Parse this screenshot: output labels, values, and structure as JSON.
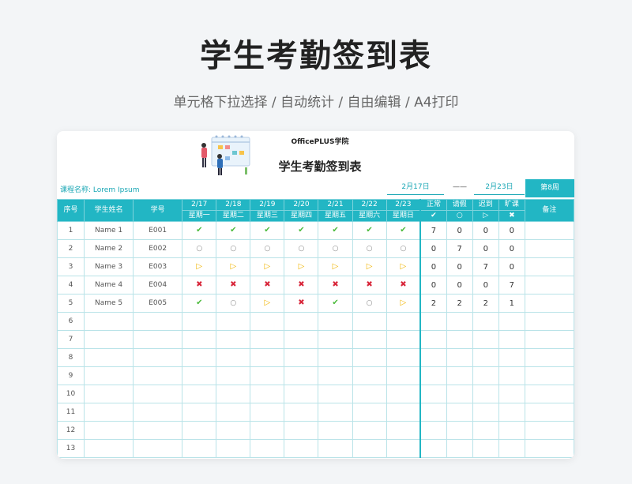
{
  "header": {
    "title": "学生考勤签到表",
    "subtitle": "单元格下拉选择 / 自动统计 / 自由编辑 / A4打印"
  },
  "sheet": {
    "org": "OfficePLUS学院",
    "title": "学生考勤签到表",
    "course_label": "课程名称:",
    "course_name": "Lorem Ipsum",
    "start_date": "2月17日",
    "separator": "——",
    "end_date": "2月23日",
    "week": "第8周"
  },
  "columns": {
    "seq": "序号",
    "name": "学生姓名",
    "id": "学号",
    "dates": [
      "2/17",
      "2/18",
      "2/19",
      "2/20",
      "2/21",
      "2/22",
      "2/23"
    ],
    "weekdays": [
      "星期一",
      "星期二",
      "星期三",
      "星期四",
      "星期五",
      "星期六",
      "星期日"
    ],
    "summary": [
      {
        "label": "正常",
        "symbol": "✔"
      },
      {
        "label": "请假",
        "symbol": "○"
      },
      {
        "label": "迟到",
        "symbol": "▷"
      },
      {
        "label": "旷课",
        "symbol": "✖"
      }
    ],
    "note": "备注"
  },
  "status_colors": {
    "check": "#4cbb3c",
    "leave": "#888888",
    "late": "#f0b400",
    "absent": "#d8263a",
    "accent": "#22b6c4"
  },
  "rows": [
    {
      "seq": "1",
      "name": "Name 1",
      "id": "E001",
      "marks": [
        "✔",
        "✔",
        "✔",
        "✔",
        "✔",
        "✔",
        "✔"
      ],
      "counts": [
        "7",
        "0",
        "0",
        "0"
      ],
      "note": ""
    },
    {
      "seq": "2",
      "name": "Name 2",
      "id": "E002",
      "marks": [
        "○",
        "○",
        "○",
        "○",
        "○",
        "○",
        "○"
      ],
      "counts": [
        "0",
        "7",
        "0",
        "0"
      ],
      "note": ""
    },
    {
      "seq": "3",
      "name": "Name 3",
      "id": "E003",
      "marks": [
        "▷",
        "▷",
        "▷",
        "▷",
        "▷",
        "▷",
        "▷"
      ],
      "counts": [
        "0",
        "0",
        "7",
        "0"
      ],
      "note": ""
    },
    {
      "seq": "4",
      "name": "Name 4",
      "id": "E004",
      "marks": [
        "✖",
        "✖",
        "✖",
        "✖",
        "✖",
        "✖",
        "✖"
      ],
      "counts": [
        "0",
        "0",
        "0",
        "7"
      ],
      "note": ""
    },
    {
      "seq": "5",
      "name": "Name 5",
      "id": "E005",
      "marks": [
        "✔",
        "○",
        "▷",
        "✖",
        "✔",
        "○",
        "▷"
      ],
      "counts": [
        "2",
        "2",
        "2",
        "1"
      ],
      "note": ""
    },
    {
      "seq": "6",
      "name": "",
      "id": "",
      "marks": [
        "",
        "",
        "",
        "",
        "",
        "",
        ""
      ],
      "counts": [
        "",
        "",
        "",
        ""
      ],
      "note": ""
    },
    {
      "seq": "7",
      "name": "",
      "id": "",
      "marks": [
        "",
        "",
        "",
        "",
        "",
        "",
        ""
      ],
      "counts": [
        "",
        "",
        "",
        ""
      ],
      "note": ""
    },
    {
      "seq": "8",
      "name": "",
      "id": "",
      "marks": [
        "",
        "",
        "",
        "",
        "",
        "",
        ""
      ],
      "counts": [
        "",
        "",
        "",
        ""
      ],
      "note": ""
    },
    {
      "seq": "9",
      "name": "",
      "id": "",
      "marks": [
        "",
        "",
        "",
        "",
        "",
        "",
        ""
      ],
      "counts": [
        "",
        "",
        "",
        ""
      ],
      "note": ""
    },
    {
      "seq": "10",
      "name": "",
      "id": "",
      "marks": [
        "",
        "",
        "",
        "",
        "",
        "",
        ""
      ],
      "counts": [
        "",
        "",
        "",
        ""
      ],
      "note": ""
    },
    {
      "seq": "11",
      "name": "",
      "id": "",
      "marks": [
        "",
        "",
        "",
        "",
        "",
        "",
        ""
      ],
      "counts": [
        "",
        "",
        "",
        ""
      ],
      "note": ""
    },
    {
      "seq": "12",
      "name": "",
      "id": "",
      "marks": [
        "",
        "",
        "",
        "",
        "",
        "",
        ""
      ],
      "counts": [
        "",
        "",
        "",
        ""
      ],
      "note": ""
    },
    {
      "seq": "13",
      "name": "",
      "id": "",
      "marks": [
        "",
        "",
        "",
        "",
        "",
        "",
        ""
      ],
      "counts": [
        "",
        "",
        "",
        ""
      ],
      "note": ""
    }
  ]
}
